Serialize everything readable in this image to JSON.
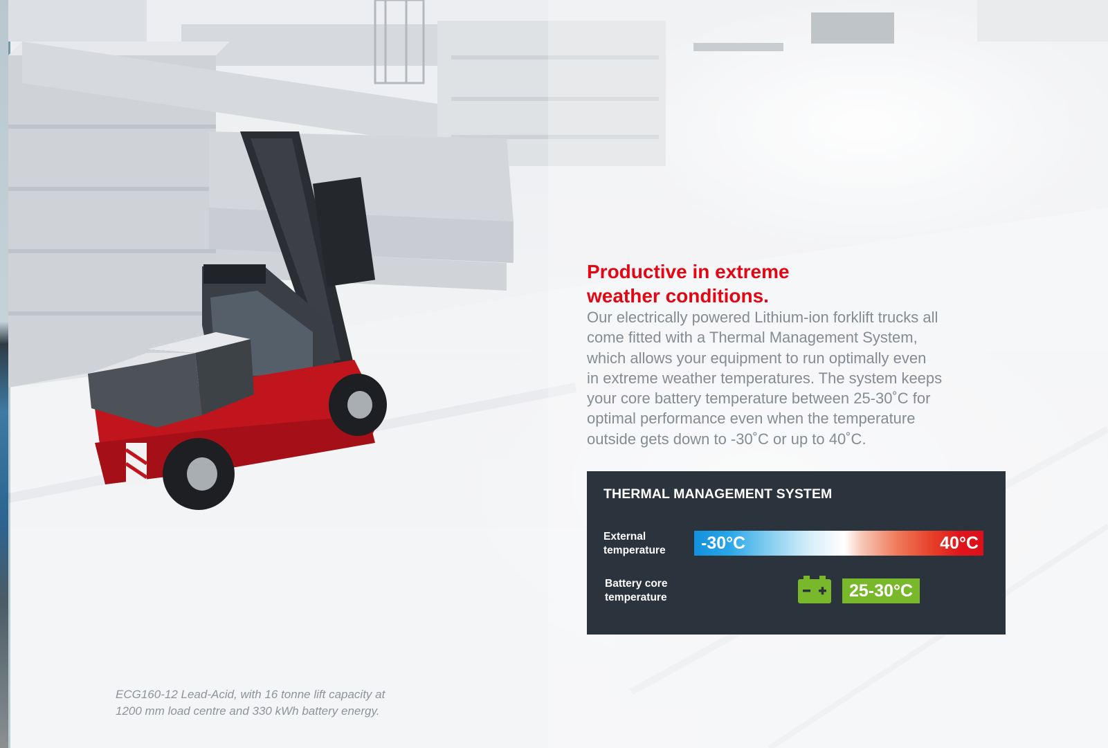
{
  "headline": {
    "lines": [
      "Productive in extreme",
      "weather conditions."
    ]
  },
  "body": {
    "lines": [
      "Our electrically powered Lithium-ion forklift trucks all",
      "come fitted with a Thermal Management System,",
      "which allows your equipment to run optimally even",
      "in extreme weather temperatures. The system keeps",
      "your core battery temperature between 25-30˚C for",
      "optimal performance even when the temperature",
      "outside gets down to -30˚C or up to 40˚C."
    ]
  },
  "thermal_panel": {
    "title": "THERMAL MANAGEMENT SYSTEM",
    "external": {
      "label_lines": [
        "External",
        "temperature"
      ],
      "min": "-30°C",
      "max": "40°C"
    },
    "battery": {
      "label_lines": [
        "Battery core",
        "temperature"
      ],
      "range": "25-30°C",
      "icon": "battery-icon"
    }
  },
  "caption": {
    "lines": [
      "ECG160-12 Lead-Acid, with 16 tonne lift capacity at",
      "1200 mm load centre and 330 kWh battery energy."
    ]
  },
  "colors": {
    "headline_red": "#e30613",
    "panel_bg": "#2b333d",
    "battery_green": "#7ab82b",
    "cold_blue": "#1390dc",
    "hot_red": "#dc0f1a",
    "body_grey": "#858b92",
    "forklift_red": "#c0151d"
  }
}
